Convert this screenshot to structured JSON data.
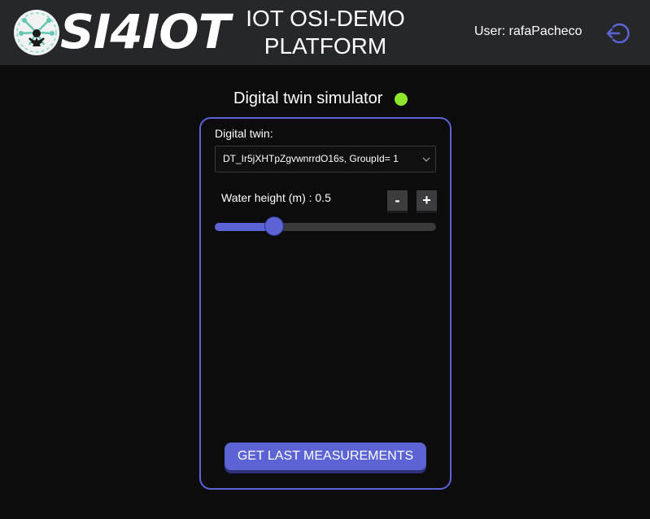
{
  "header": {
    "logo_text": "SI4IOT",
    "title_line1": "IOT OSI-DEMO",
    "title_line2": "PLATFORM",
    "user_label": "User: rafaPacheco",
    "logout_icon": "logout-icon"
  },
  "simulator": {
    "title": "Digital twin simulator",
    "status_color": "#8ee62c",
    "digital_twin_label": "Digital twin:",
    "digital_twin_value": "DT_Ir5jXHTpZgvwnrrdO16s, GroupId= 1",
    "water_height_label": "Water height (m) : 0.5",
    "water_height_fraction": 0.27,
    "minus_label": "-",
    "plus_label": "+",
    "measure_button_label": "GET LAST MEASUREMENTS"
  },
  "colors": {
    "accent": "#5c63d4",
    "status_online": "#8ee62c",
    "header_bg": "#26272a",
    "page_bg": "#0c0c0d"
  }
}
